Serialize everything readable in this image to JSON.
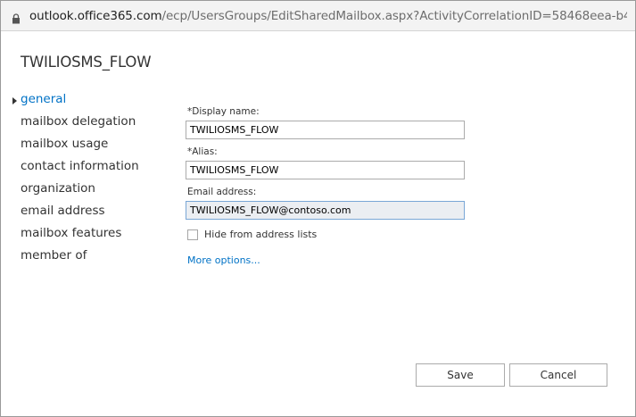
{
  "browser": {
    "url_domain": "outlook.office365.com",
    "url_path": "/ecp/UsersGroups/EditSharedMailbox.aspx?ActivityCorrelationID=58468eea-b460-..."
  },
  "page": {
    "title": "TWILIOSMS_FLOW"
  },
  "nav": {
    "items": [
      {
        "label": "general",
        "selected": true
      },
      {
        "label": "mailbox delegation",
        "selected": false
      },
      {
        "label": "mailbox usage",
        "selected": false
      },
      {
        "label": "contact information",
        "selected": false
      },
      {
        "label": "organization",
        "selected": false
      },
      {
        "label": "email address",
        "selected": false
      },
      {
        "label": "mailbox features",
        "selected": false
      },
      {
        "label": "member of",
        "selected": false
      }
    ]
  },
  "form": {
    "display_name": {
      "label": "*Display name:",
      "value": "TWILIOSMS_FLOW"
    },
    "alias": {
      "label": "*Alias:",
      "value": "TWILIOSMS_FLOW"
    },
    "email": {
      "label": "Email address:",
      "value": "TWILIOSMS_FLOW@contoso.com"
    },
    "hide_checkbox": {
      "label": "Hide from address lists",
      "checked": false
    },
    "more_options": "More options..."
  },
  "buttons": {
    "save": "Save",
    "cancel": "Cancel"
  },
  "colors": {
    "accent": "#0072c6",
    "readonly_bg": "#ebeef2"
  }
}
